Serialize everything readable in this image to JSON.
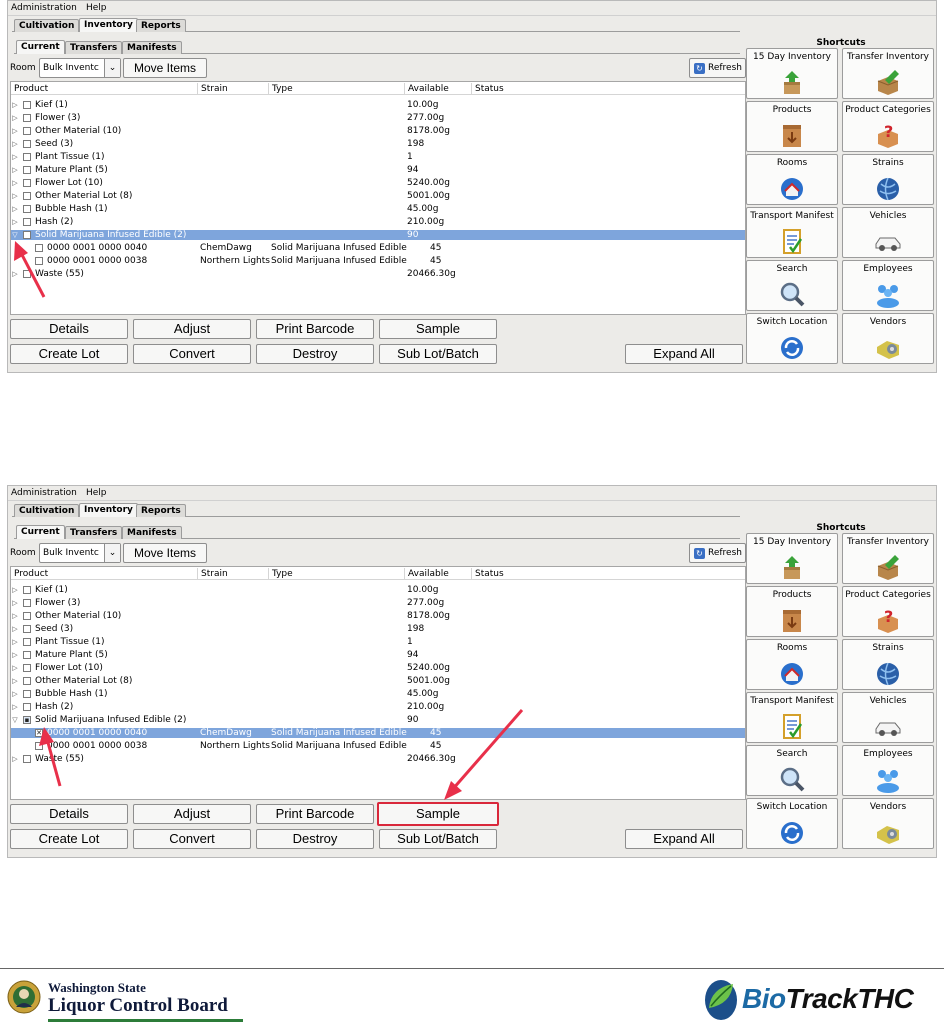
{
  "menu": {
    "administration": "Administration",
    "help": "Help"
  },
  "top_tabs": [
    "Cultivation",
    "Inventory",
    "Reports"
  ],
  "sub_tabs": [
    "Current",
    "Transfers",
    "Manifests"
  ],
  "toolbar": {
    "room_label": "Room",
    "room_value": "Bulk Inventc",
    "move_items": "Move Items",
    "refresh": "Refresh"
  },
  "columns": {
    "product": "Product",
    "strain": "Strain",
    "type": "Type",
    "available": "Available",
    "status": "Status"
  },
  "rows": [
    {
      "product": "Kief (1)",
      "available": "10.00g"
    },
    {
      "product": "Flower (3)",
      "available": "277.00g"
    },
    {
      "product": "Other Material (10)",
      "available": "8178.00g"
    },
    {
      "product": "Seed (3)",
      "available": "198"
    },
    {
      "product": "Plant Tissue (1)",
      "available": "1"
    },
    {
      "product": "Mature Plant (5)",
      "available": "94"
    },
    {
      "product": "Flower Lot (10)",
      "available": "5240.00g"
    },
    {
      "product": "Other Material Lot (8)",
      "available": "5001.00g"
    },
    {
      "product": "Bubble Hash (1)",
      "available": "45.00g"
    },
    {
      "product": "Hash (2)",
      "available": "210.00g"
    },
    {
      "product": "Solid Marijuana Infused Edible (2)",
      "available": "90"
    },
    {
      "product": "0000 0001 0000 0040",
      "strain": "ChemDawg",
      "type": "Solid Marijuana Infused Edible",
      "available": "45"
    },
    {
      "product": "0000 0001 0000 0038",
      "strain": "Northern Lights",
      "type": "Solid Marijuana Infused Edible",
      "available": "45"
    },
    {
      "product": "Waste (55)",
      "available": "20466.30g"
    }
  ],
  "buttons": {
    "details": "Details",
    "adjust": "Adjust",
    "print_barcode": "Print Barcode",
    "sample": "Sample",
    "create_lot": "Create Lot",
    "convert": "Convert",
    "destroy": "Destroy",
    "sub_lot_batch": "Sub Lot/Batch",
    "expand_all": "Expand All"
  },
  "shortcuts": {
    "title": "Shortcuts",
    "items": [
      "15 Day Inventory",
      "Transfer Inventory",
      "Products",
      "Product Categories",
      "Rooms",
      "Strains",
      "Transport Manifest",
      "Vehicles",
      "Search",
      "Employees",
      "Switch Location",
      "Vendors"
    ]
  },
  "footer": {
    "wslcb_line1": "Washington State",
    "wslcb_line2": "Liquor Control Board",
    "biotrack_bio": "Bio",
    "biotrack_rest": "TrackTHC"
  },
  "colors": {
    "selection": "#7ea5dc",
    "highlight": "#d9283b",
    "arrow": "#e8304a"
  }
}
